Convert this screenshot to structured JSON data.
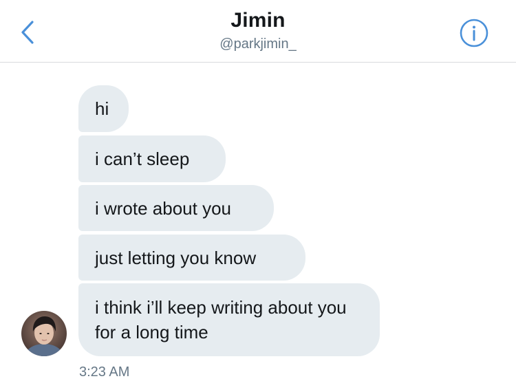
{
  "header": {
    "title": "Jimin",
    "handle": "@parkjimin_",
    "back_icon": "chevron-left-icon",
    "info_icon": "info-circle-icon",
    "accent_color": "#4a90d9"
  },
  "conversation": {
    "messages": [
      {
        "text": "hi"
      },
      {
        "text": "i can’t sleep"
      },
      {
        "text": "i wrote about you"
      },
      {
        "text": "just letting you know"
      },
      {
        "text": "i think i’ll keep writing about you for a long time"
      }
    ],
    "timestamp": "3:23 AM",
    "bubble_color": "#e6ecf0"
  }
}
